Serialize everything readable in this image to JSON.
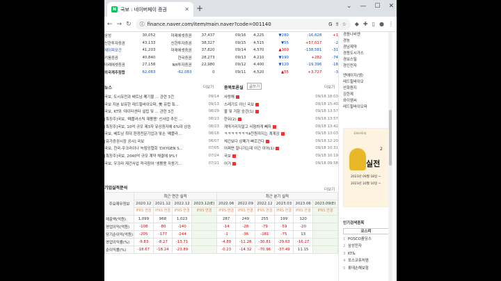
{
  "browser": {
    "tab_title": "국보 : 네이버페이 증권",
    "url": "finance.naver.com/item/main.naver?code=001140"
  },
  "top_table": [
    [
      "삼성",
      "30,052",
      "미래에셋증권",
      "37,437",
      "09/16",
      "4,225",
      "▼280",
      "-16,628",
      "+1"
    ],
    [
      "신한투자증권",
      "43,133",
      "신한투자증권",
      "38,327",
      "09/15",
      "4,515",
      "▼55",
      "+57,017",
      "-2"
    ],
    [
      "제이피모간",
      "41,203",
      "미래에셋증권",
      "37,820",
      "09/14",
      "4,570",
      "▲360",
      "-138,581",
      "-31"
    ],
    [
      "키움증권",
      "40,840",
      "한국증권",
      "28,273",
      "09/13",
      "4,210",
      "▼190",
      "+282",
      "-74"
    ],
    [
      "미래에셋증권",
      "27,158",
      "NH투자증권",
      "22,980",
      "09/12",
      "4,400",
      "▼120",
      "-19,396",
      "-18"
    ],
    [
      "외국계추정합",
      "62,083",
      "-62,083",
      "0",
      "09/11",
      "4,520",
      "▲55",
      "+3,727",
      "-3"
    ]
  ],
  "news": {
    "title": "뉴스",
    "more": "더보기",
    "items": [
      {
        "t": "국보, 도시유전과 배트남 폐기물 ... 관련 3건",
        "d": "09/14"
      },
      {
        "t": "국보 지분 보유한 레드힐바이오파, 美 유럽 특...",
        "d": "09/13"
      },
      {
        "t": "국보, KT와 '데이터센터 설립 및 ... 관련 3건",
        "d": "08/29"
      },
      {
        "t": "[특징주]국보, '폐플라스틱 재활용' 신사업 추진 ...",
        "d": "08/23"
      },
      {
        "t": "[특징주]국보, 10억 규모 제3자 유상증자에 6%대 상승",
        "d": "08/23"
      },
      {
        "t": "국보, 베트남 최대 환경전문기업과 맞손 '폐플라...",
        "d": "08/16"
      },
      {
        "t": "[유가증권시장 공시] 국보",
        "d": "08/07"
      },
      {
        "t": "국보, 한국-우크라이나 녹림잉협회 'DXYGEN S...",
        "d": "07/05"
      },
      {
        "t": "[특징주]국보, 2040억 규모 계약 체결에 9%↑",
        "d": "07/24"
      },
      {
        "t": "국보, 우크라 재건사업 적극참여 '생활용 자동기...",
        "d": "07/21"
      }
    ]
  },
  "board": {
    "title": "종목토론실",
    "write": "글쓰기",
    "more": "더보기",
    "items": [
      {
        "t": "사랑해",
        "d": "09/18 18:03"
      },
      {
        "t": "스레기도 아닌 국보",
        "d": "09/18 15:40"
      },
      {
        "t": "물 및 거함 승간(1)",
        "d": "09/18 13:57"
      },
      {
        "t": "한뒤(2)",
        "d": "09/18 13:57"
      },
      {
        "t": "계약거리지말고 사형하게 빼자",
        "d": "09/18 13:42"
      },
      {
        "t": "ㅋㅋㅋㅋㅋㅋㅋ4천원까지는 계계감",
        "d": "09/18 13:03"
      },
      {
        "t": "체긴보다 상폐가 빠르건다",
        "d": "09/18 12:20"
      },
      {
        "t": "어쩌면 잘나가는데 어긴 이어(1)",
        "d": "09/18 10:31"
      },
      {
        "t": "국보",
        "d": "09/18 10:19"
      },
      {
        "t": "어거",
        "d": "09/18 09:58"
      }
    ]
  },
  "financials": {
    "title": "기업실적분석",
    "more": "더보기",
    "label_col": "주요재무정보",
    "annual_label": "최근 연간 실적",
    "quarter_label": "최근 분기 실적",
    "periods": [
      "2020.12",
      "2021.12",
      "2022.12",
      "2023.12(E)",
      "2022.06",
      "2022.09",
      "2022.12",
      "2023.03",
      "2023.06",
      "2023.09(E)"
    ],
    "standard": "IFRS 연결",
    "rows": [
      {
        "name": "매출액(억원)",
        "vals": [
          "1,099",
          "968",
          "1,023",
          "",
          "287",
          "249",
          "255",
          "199",
          "120",
          ""
        ]
      },
      {
        "name": "영업이익(억원)",
        "vals": [
          "-108",
          "-80",
          "-140",
          "",
          "-14",
          "-28",
          "-79",
          "-59",
          "-20",
          ""
        ]
      },
      {
        "name": "당기순이익(억원)",
        "vals": [
          "-205",
          "-177",
          "-244",
          "",
          "-1",
          "-36",
          "-181",
          "-75",
          "13",
          ""
        ]
      },
      {
        "name": "영업이익률(%)",
        "vals": [
          "-9.83",
          "-8.27",
          "-13.71",
          "",
          "-4.89",
          "-11.28",
          "-30.81",
          "-29.63",
          "-16.27",
          ""
        ]
      },
      {
        "name": "순이익률(%)",
        "vals": [
          "-18.67",
          "-18.24",
          "-23.89",
          "",
          "-0.23",
          "-14.32",
          "-70.96",
          "-37.49",
          "11.15",
          ""
        ]
      }
    ]
  },
  "sidebar": {
    "top_items": [
      "경동나비엔",
      "경농",
      "경남제약",
      "경동도시가스",
      "경보스틸",
      "경인전자"
    ],
    "mid_items": [
      "엔에이지(엠)",
      "레드힐바이오",
      "산화원지",
      "김한제",
      "와이엠씨",
      "레드힐바이오파"
    ],
    "ad": {
      "header": "국보스토리",
      "big": "실전",
      "num": "2",
      "line1": "2023년 09월 18일 ~",
      "line2": "2023년 10월 10일 ~"
    },
    "popular": {
      "title": "인기검색종목",
      "tab": "코스피",
      "items": [
        {
          "n": "1",
          "name": "POSCO홀딩스"
        },
        {
          "n": "2",
          "name": "삼성전자"
        },
        {
          "n": "3",
          "name": "KT&"
        },
        {
          "n": "4",
          "name": "포스코퓨처엠"
        },
        {
          "n": "5",
          "name": "롯데손해보험"
        }
      ]
    }
  }
}
